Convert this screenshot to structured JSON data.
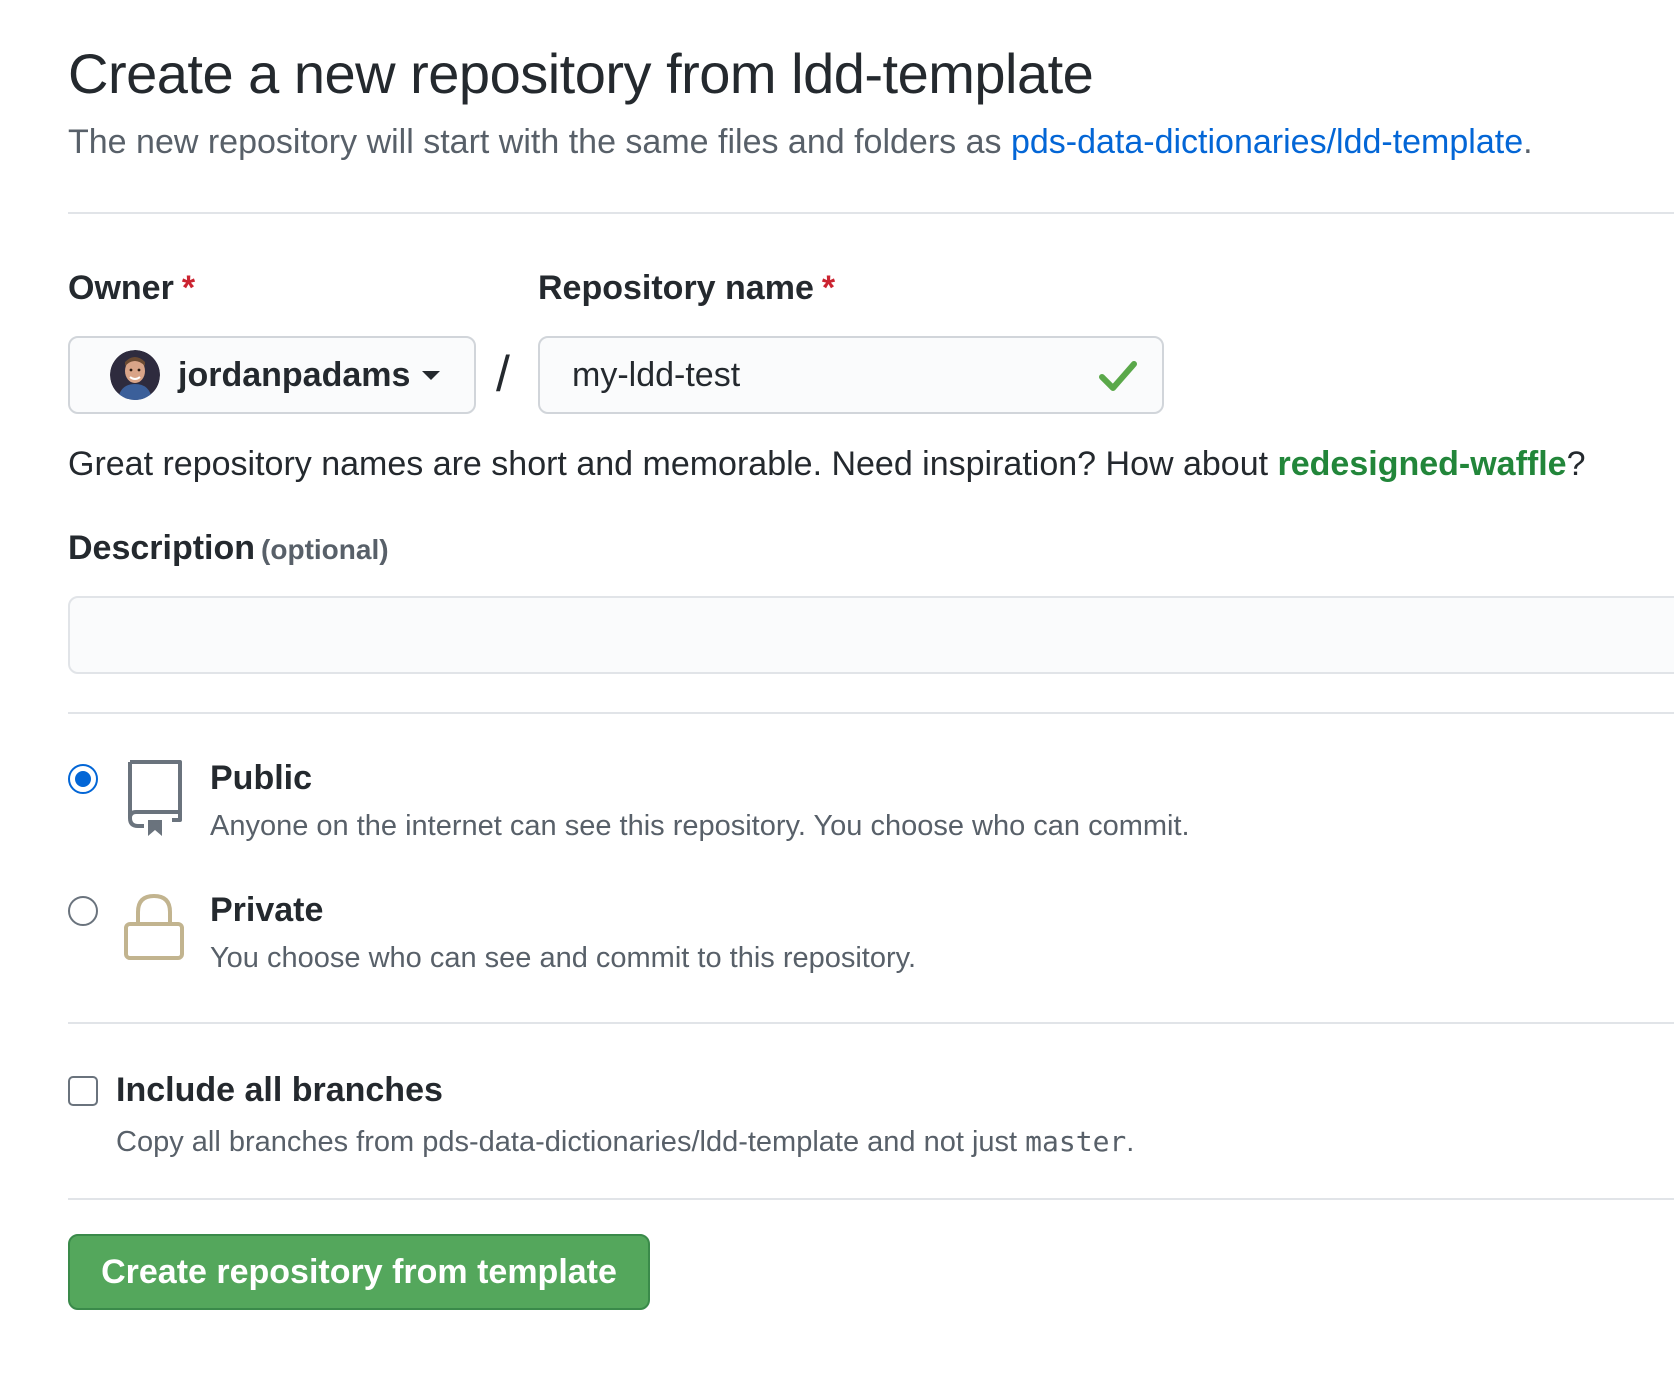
{
  "header": {
    "title": "Create a new repository from ldd-template",
    "subtitle_prefix": "The new repository will start with the same files and folders as ",
    "subtitle_link": "pds-data-dictionaries/ldd-template",
    "subtitle_suffix": "."
  },
  "form": {
    "owner": {
      "label": "Owner",
      "required_mark": "*",
      "value": "jordanpadams"
    },
    "separator": "/",
    "repo_name": {
      "label": "Repository name",
      "required_mark": "*",
      "value": "my-ldd-test",
      "valid": true
    },
    "name_hint": {
      "prefix": "Great repository names are short and memorable. Need inspiration? How about ",
      "suggestion": "redesigned-waffle",
      "suffix": "?"
    },
    "description": {
      "label": "Description",
      "optional_label": "(optional)",
      "value": ""
    },
    "visibility": {
      "selected": "public",
      "options": [
        {
          "id": "public",
          "title": "Public",
          "description": "Anyone on the internet can see this repository. You choose who can commit.",
          "icon": "repo-icon"
        },
        {
          "id": "private",
          "title": "Private",
          "description": "You choose who can see and commit to this repository.",
          "icon": "lock-icon"
        }
      ]
    },
    "include_branches": {
      "checked": false,
      "title": "Include all branches",
      "description_prefix": "Copy all branches from pds-data-dictionaries/ldd-template and not just ",
      "branch": "master",
      "description_suffix": "."
    },
    "submit_label": "Create repository from template"
  },
  "colors": {
    "link": "#0366d6",
    "required": "#cb2431",
    "suggestion": "#22863a",
    "check": "#5aa84a",
    "primary_button": "#54a75c",
    "radio_selected": "#0366d6",
    "lock_icon": "#c2b48f",
    "repo_icon": "#6a737d"
  }
}
